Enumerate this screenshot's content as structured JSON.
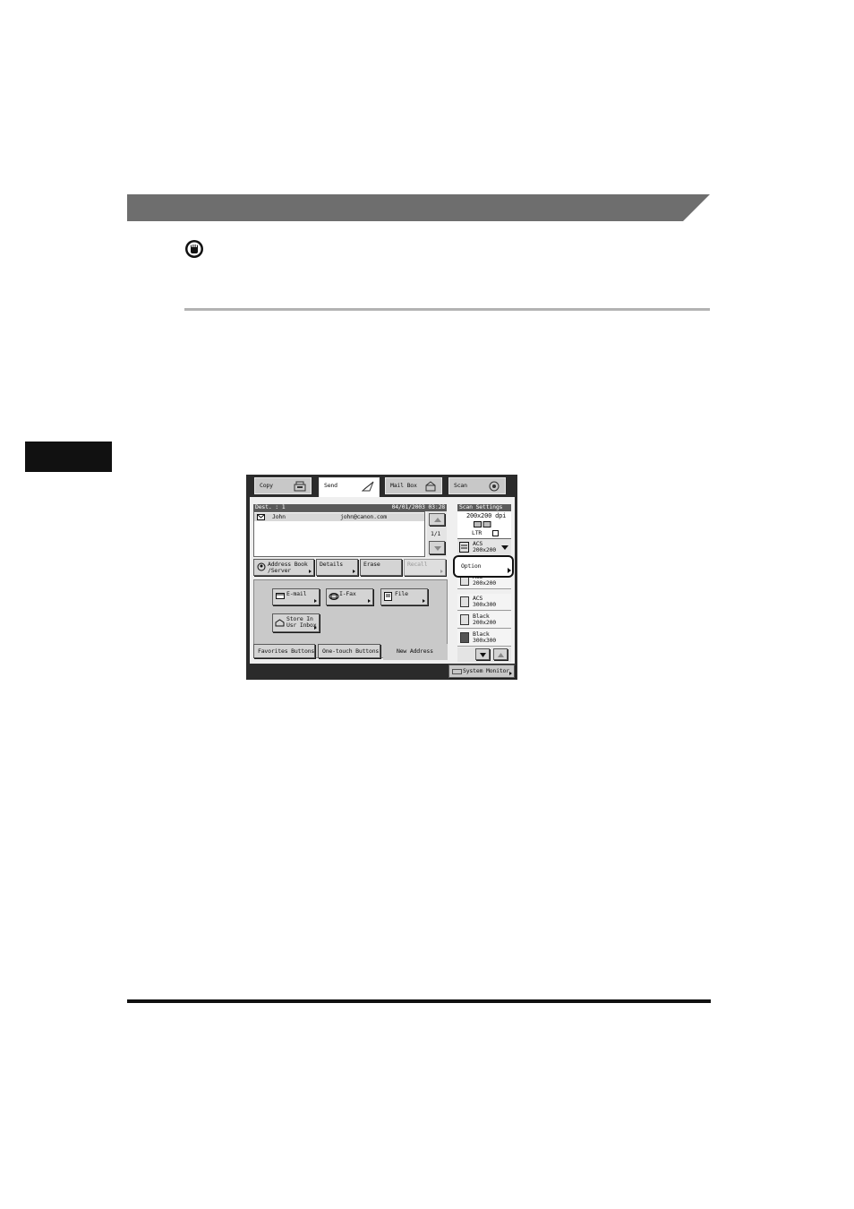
{
  "panel": {
    "tabs": [
      {
        "label": "Copy",
        "icon": "copier-icon"
      },
      {
        "label": "Send",
        "icon": "send-icon"
      },
      {
        "label": "Mail Box",
        "icon": "mailbox-icon"
      },
      {
        "label": "Scan",
        "icon": "scan-icon"
      }
    ],
    "dest_label": "Dest. :  1",
    "datetime": "04/01/2003 03:28",
    "dest_row": {
      "name": "John",
      "address": "john@canon.com"
    },
    "page_indicator": "1/1",
    "action_buttons": {
      "address_book": "Address Book\n/Server",
      "details": "Details",
      "erase": "Erase",
      "recall": "Recall"
    },
    "send_types": {
      "email": "E-mail",
      "ifax": "I-Fax",
      "file": "File",
      "store": "Store In\nUsr Inbox"
    },
    "bottom_tabs": {
      "favorites": "Favorites Buttons",
      "one_touch": "One-touch Buttons",
      "new_address": "New Address"
    },
    "scan_settings": {
      "title": "Scan Settings",
      "resolution": "200x200 dpi",
      "size": "LTR",
      "current_mode": "ACS\n200x200",
      "option_label": "Option",
      "list": [
        {
          "label": "ACS\n200x200"
        },
        {
          "label": "ACS\n300x300"
        },
        {
          "label": "Black\n200x200"
        },
        {
          "label": "Black\n300x300"
        }
      ]
    },
    "system_monitor": "System Monitor"
  }
}
